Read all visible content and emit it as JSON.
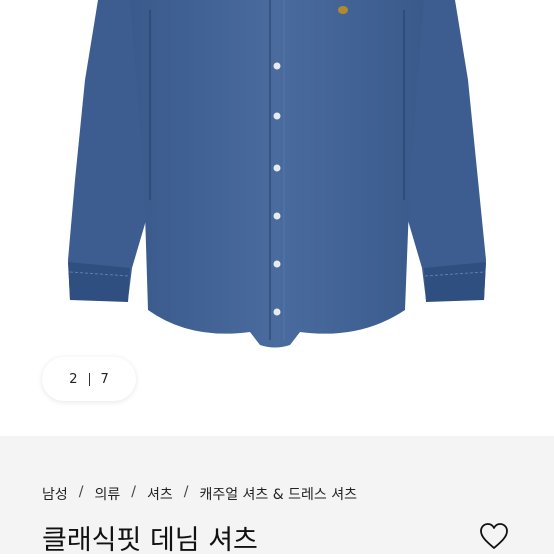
{
  "gallery": {
    "counter": {
      "current": "2",
      "total": "7"
    },
    "image_colors": {
      "denim": "#3e5f92",
      "denim_dark": "#2d4a78",
      "button": "#e6ebef",
      "logo": "#b08a2e"
    }
  },
  "product": {
    "breadcrumb": [
      "남성",
      "의류",
      "셔츠",
      "캐주얼 셔츠 & 드레스 셔츠"
    ],
    "title": "클래식핏 데님 셔츠"
  },
  "icons": {
    "wishlist": "heart-outline-icon"
  }
}
